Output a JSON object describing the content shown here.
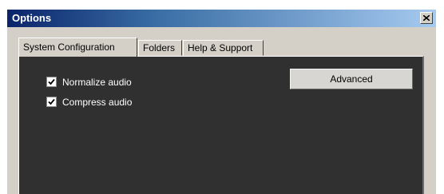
{
  "window": {
    "title": "Options",
    "close_icon": "close-icon",
    "colors": {
      "title_start": "#0a246a",
      "title_end": "#a6caf0",
      "chrome": "#d4d0c8",
      "panel": "#303030"
    }
  },
  "tabs": [
    {
      "label": "System Configuration",
      "active": true
    },
    {
      "label": "Folders",
      "active": false
    },
    {
      "label": "Help & Support",
      "active": false
    }
  ],
  "options": [
    {
      "label": "Normalize audio",
      "checked": true
    },
    {
      "label": "Compress audio",
      "checked": true
    }
  ],
  "advanced_button": {
    "label": "Advanced"
  }
}
